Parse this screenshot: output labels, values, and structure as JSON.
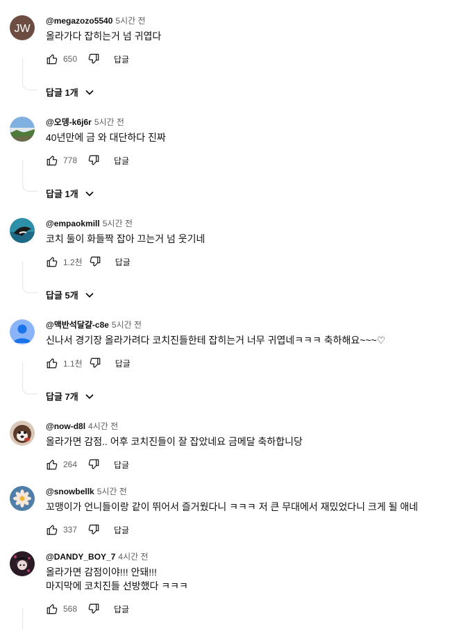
{
  "labels": {
    "reply": "답글"
  },
  "comments": [
    {
      "author": "@megazozo5540",
      "time": "5시간 전",
      "lines": [
        "올라가다 잡히는거 넘 귀엽다"
      ],
      "likes": "650",
      "replies": "답글 1개",
      "avatar": {
        "kind": "initials",
        "initials": "JW",
        "color": "#6d4c41"
      }
    },
    {
      "author": "@오뎅-k6j6r",
      "time": "5시간 전",
      "lines": [
        "40년만에 금 와 대단하다 진짜"
      ],
      "likes": "778",
      "replies": "답글 1개",
      "avatar": {
        "kind": "landscape"
      }
    },
    {
      "author": "@empaokmill",
      "time": "5시간 전",
      "lines": [
        "코치 둘이 화들짝 잡아 끄는거 넘 웃기네"
      ],
      "likes": "1.2천",
      "replies": "답글 5개",
      "avatar": {
        "kind": "ocean"
      }
    },
    {
      "author": "@맥반석달걀-c8e",
      "time": "5시간 전",
      "lines": [
        "신나서 경기장 올라가려다 코치진들한테 잡히는거 너무 귀엽네ㅋㅋㅋ 축하해요~~~♡"
      ],
      "likes": "1.1천",
      "replies": "답글 7개",
      "avatar": {
        "kind": "default",
        "color": "#8ab4f8"
      }
    },
    {
      "author": "@now-d8l",
      "time": "4시간 전",
      "lines": [
        "올라가면 감점.. 어후 코치진들이 잘 잡았네요 금메달 축하합니당"
      ],
      "likes": "264",
      "replies": null,
      "avatar": {
        "kind": "dog"
      }
    },
    {
      "author": "@snowbellk",
      "time": "5시간 전",
      "lines": [
        "꼬맹이가 언니들이랑 같이 뛰어서 즐거웠다니 ㅋㅋㅋ 저 큰 무대에서 재밌었다니 크게 될 애네"
      ],
      "likes": "337",
      "replies": null,
      "avatar": {
        "kind": "flower"
      }
    },
    {
      "author": "@DANDY_BOY_7",
      "time": "4시간 전",
      "lines": [
        "올라가면 감점이야!!! 안돼!!!",
        "마지막에 코치진들 선방했다 ㅋㅋㅋ"
      ],
      "likes": "568",
      "replies": null,
      "avatar": {
        "kind": "dark"
      }
    }
  ]
}
